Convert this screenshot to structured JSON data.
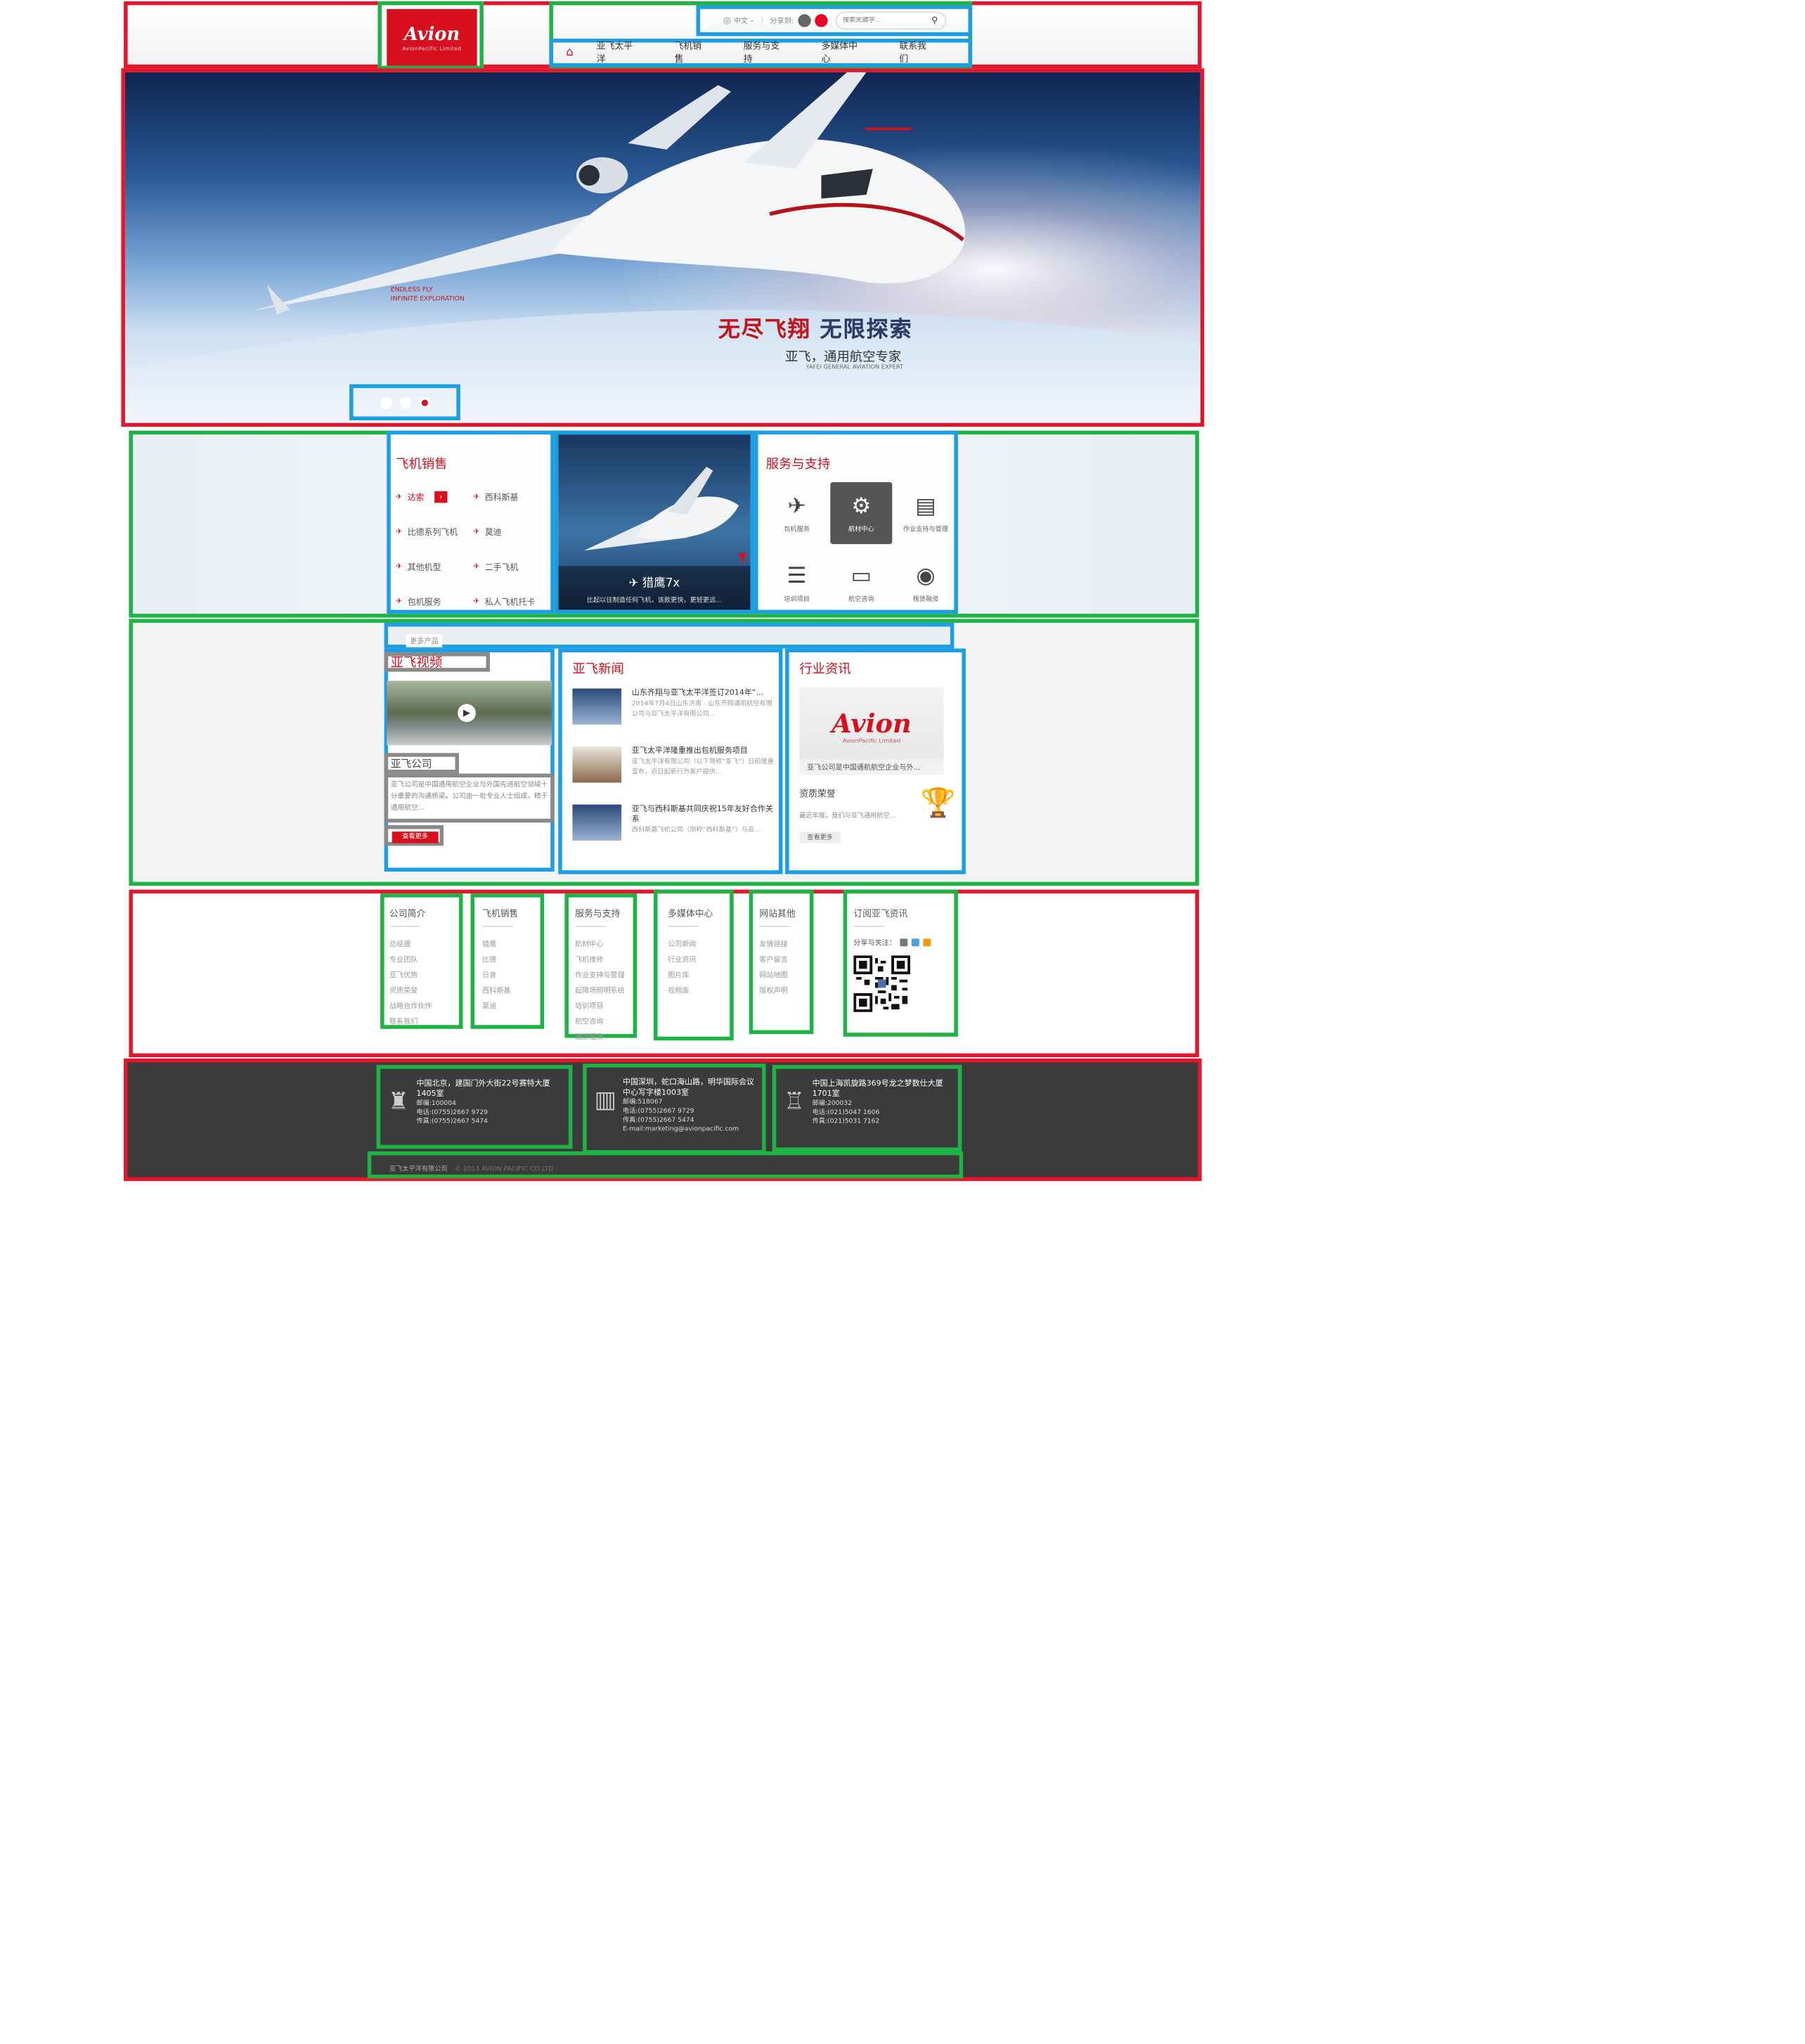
{
  "header": {
    "logo_text": "Avion",
    "logo_sub": "AvionPacific Limited",
    "language": "中文",
    "share_label": "分享到:",
    "search_placeholder": "搜索关键字...",
    "nav": [
      "亚飞太平洋",
      "飞机销售",
      "服务与支持",
      "多媒体中心",
      "联系我们"
    ]
  },
  "banner": {
    "slogan_red": "无尽飞翔",
    "slogan_navy": "无限探索",
    "subtitle": "亚飞，通用航空专家",
    "subtitle_en": "YAFEI GENERAL AVIATION EXPERT",
    "tagline_line1": "ENDLESS FLY",
    "tagline_line2": "INFINITE EXPLORATION",
    "slides": 3,
    "active_slide": 3
  },
  "sales": {
    "title": "飞机销售",
    "items": [
      "达索",
      "西科斯基",
      "比德系列飞机",
      "莫迪",
      "其他机型",
      "二手飞机",
      "包机服务",
      "私人飞机托卡"
    ]
  },
  "feature": {
    "title": "猎鹰7x",
    "desc": "比起以往制造任何飞机，该款更快，更轻更远..."
  },
  "service": {
    "title": "服务与支持",
    "items": [
      {
        "label": "包机服务",
        "icon": "plane-check-icon"
      },
      {
        "label": "航材中心",
        "icon": "parts-icon"
      },
      {
        "label": "作业支持与管理",
        "icon": "server-clock-icon"
      },
      {
        "label": "培训项目",
        "icon": "checklist-icon"
      },
      {
        "label": "航空咨询",
        "icon": "chat-icon"
      },
      {
        "label": "租赁融资",
        "icon": "coins-icon"
      }
    ]
  },
  "middle": {
    "tab_label": "更多产品",
    "video_title": "亚飞视频",
    "company_label": "亚飞公司",
    "company_desc": "亚飞公司是中国通用航空企业与外国先进航空领域十分重要的沟通桥梁。公司由一批专业人士组成，精于通用航空...",
    "more_label": "查看更多",
    "news_title": "亚飞新闻",
    "news": [
      {
        "title": "山东齐翔与亚飞太平洋签订2014年“...",
        "desc": "2014年7月4日山东济南 - 山东齐翔通用航空有限公司与亚飞太平洋有限公司..."
      },
      {
        "title": "亚飞太平洋隆重推出包机服务项目",
        "desc": "亚飞太平洋有限公司（以下简称“亚飞”）日前隆重宣布，近日起新行为客户提供..."
      },
      {
        "title": "亚飞与西科斯基共同庆祝15年友好合作关系",
        "desc": "西科斯基飞机公司（简称“西科斯基”）与亚..."
      }
    ],
    "industry_title": "行业资讯",
    "industry_caption": "亚飞公司是中国通航航空企业与外...",
    "honor_title": "资质荣誉",
    "honor_desc": "最近年度，我们与亚飞通用航空...",
    "honor_more": "查看更多"
  },
  "footer_links": [
    {
      "heading": "公司简介",
      "items": [
        "总经理",
        "专业团队",
        "亚飞优势",
        "资质荣誉",
        "战略合作伙伴",
        "联系我们"
      ]
    },
    {
      "heading": "飞机销售",
      "items": [
        "猎鹰",
        "比德",
        "日食",
        "西科斯基",
        "莫迪"
      ]
    },
    {
      "heading": "服务与支持",
      "items": [
        "航材中心",
        "飞机维修",
        "作业支持与管理",
        "起降场照明系统",
        "培训项目",
        "航空咨询",
        "融资租赁"
      ]
    },
    {
      "heading": "多媒体中心",
      "items": [
        "公司新闻",
        "行业资讯",
        "图片库",
        "视频库"
      ]
    },
    {
      "heading": "网站其他",
      "items": [
        "友情链接",
        "客户留言",
        "网站地图",
        "版权声明"
      ]
    }
  ],
  "subscribe": {
    "heading": "订阅亚飞资讯",
    "share_label": "分享与关注："
  },
  "offices": [
    {
      "title": "中国北京，建国门外大街22号赛特大厦1405室",
      "lines": [
        "邮编:100004",
        "电话:(0755)2667 9729",
        "传真:(0755)2667 5474"
      ]
    },
    {
      "title": "中国深圳，蛇口海山路，明华国际会议中心写字楼1003室",
      "lines": [
        "邮编:518067",
        "电话:(0755)2667 9729",
        "传真:(0755)2667 5474",
        "E-mail:marketing@avionpacific.com"
      ]
    },
    {
      "title": "中国上海凯旋路369号龙之梦数仕大厦1701室",
      "lines": [
        "邮编:200032",
        "电话:(021)5047 1606",
        "传真:(021)5031 7162"
      ]
    }
  ],
  "copyright": {
    "company": "亚飞太平洋有限公司",
    "text": "© 2013 AVION PACIFIC CO LTD"
  },
  "colors": {
    "brand_red": "#d8101d",
    "dark_footer": "#3b3b3b"
  }
}
